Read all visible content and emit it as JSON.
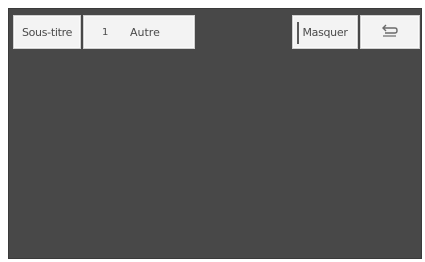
{
  "toolbar": {
    "subtitle_label": "Sous-titre",
    "track_number": "1",
    "track_label": "Autre",
    "hide_label": "Masquer",
    "back_icon": "return-arrow-icon"
  },
  "colors": {
    "screen_background": "#484848",
    "button_background": "#f3f3f3",
    "button_text": "#4a4a4a"
  }
}
